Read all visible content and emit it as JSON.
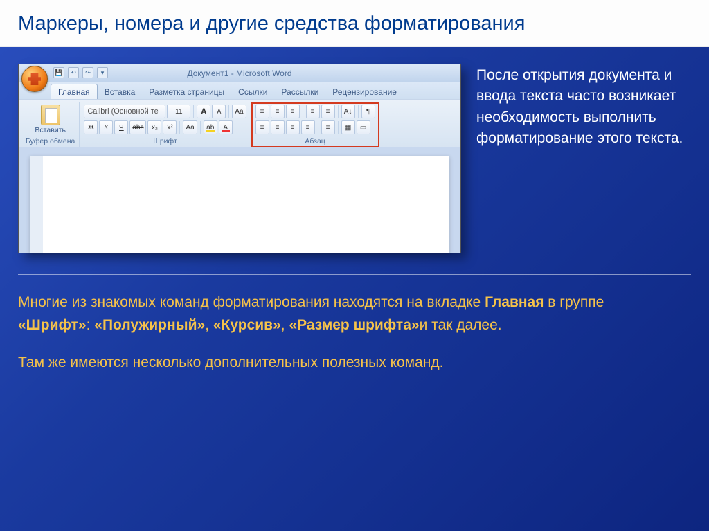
{
  "slide": {
    "title": "Маркеры, номера и другие средства форматирования"
  },
  "word": {
    "doc_title": "Документ1 - Microsoft Word",
    "tabs": [
      "Главная",
      "Вставка",
      "Разметка страницы",
      "Ссылки",
      "Рассылки",
      "Рецензирование"
    ],
    "groups": {
      "clipboard": {
        "paste": "Вставить",
        "label": "Буфер обмена"
      },
      "font": {
        "name": "Calibri (Основной те",
        "size": "11",
        "label": "Шрифт",
        "grow": "A",
        "shrink": "A",
        "clear": "Aa",
        "bold": "Ж",
        "italic": "К",
        "underline": "Ч",
        "strike": "abc",
        "sub": "x₂",
        "sup": "x²",
        "case": "Aa",
        "hilite": "ab",
        "color": "A"
      },
      "para": {
        "label": "Абзац",
        "bul": "≡",
        "num": "≡",
        "multi": "≡",
        "dedent": "≡",
        "indent": "≡",
        "sort": "A↓",
        "pilcrow": "¶",
        "al": "≡",
        "ac": "≡",
        "ar": "≡",
        "aj": "≡",
        "ls": "≡",
        "shade": "▦",
        "border": "▭"
      }
    }
  },
  "side_paragraph": "После открытия документа и ввода текста часто возникает необходимость выполнить форматирование этого текста.",
  "body": {
    "p1_a": "Многие из знакомых команд форматирования находятся на вкладке ",
    "p1_b": "Главная",
    "p1_c": " в группе ",
    "p1_d": "«Шрифт»",
    "p1_e": ": ",
    "p1_f": "«Полужирный»",
    "p1_g": ", ",
    "p1_h": "«Курсив»",
    "p1_i": ", ",
    "p1_j": "«Размер шрифта»",
    "p1_k": "и так далее.",
    "p2": "Там же имеются несколько дополнительных полезных команд."
  }
}
